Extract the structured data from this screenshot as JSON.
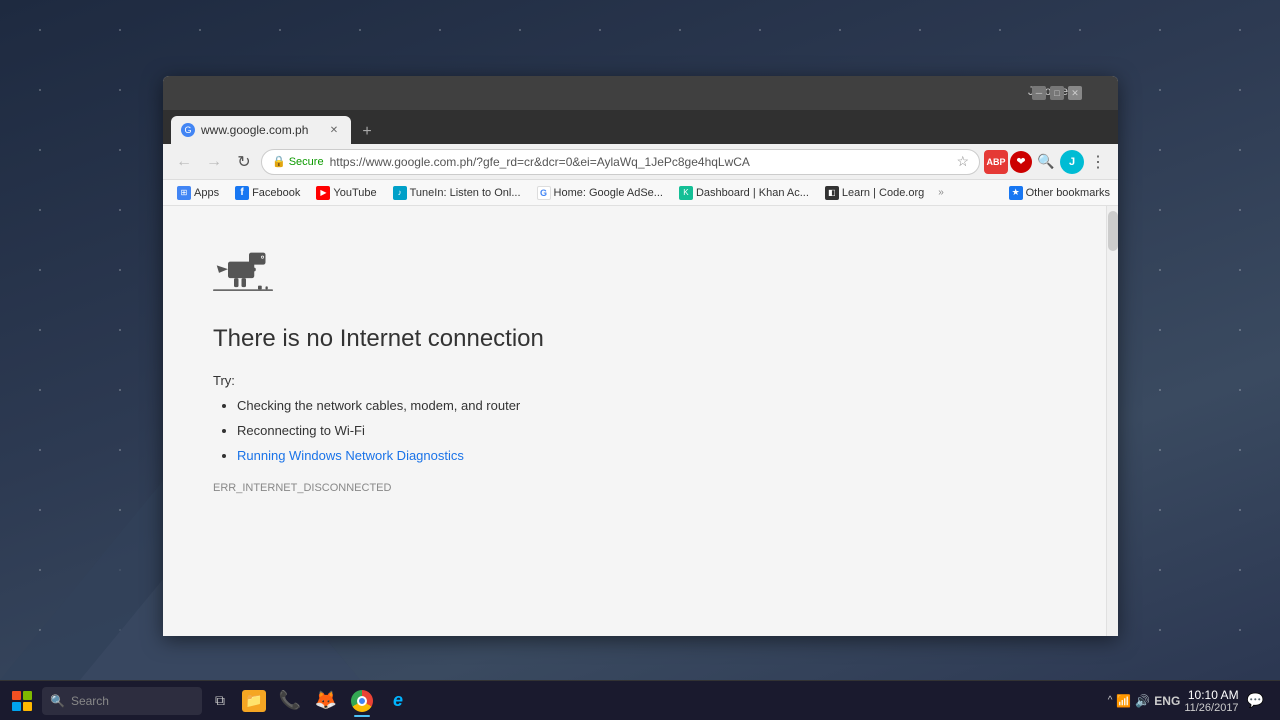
{
  "desktop": {
    "background_note": "dark blue gradient with mountain shapes"
  },
  "browser": {
    "titlebar": {
      "user": "Jerome",
      "minimize_label": "─",
      "maximize_label": "□",
      "close_label": "✕"
    },
    "tab": {
      "favicon_letter": "G",
      "title": "www.google.com.ph",
      "close_label": "✕"
    },
    "new_tab_label": "+",
    "toolbar": {
      "back_label": "←",
      "forward_label": "→",
      "reload_label": "↻",
      "secure_label": "Secure",
      "url": "https://www.google.com.ph/?gfe_rd=cr&dcr=0&ei=AylaWq_1JePc8ge4hqLwCA",
      "star_label": "☆",
      "abp_label": "ABP",
      "menu_label": "⋮"
    },
    "bookmarks": [
      {
        "id": "apps",
        "icon": "⊞",
        "label": "Apps",
        "color": "#4285f4"
      },
      {
        "id": "facebook",
        "icon": "f",
        "label": "Facebook",
        "color": "#1877f2"
      },
      {
        "id": "youtube",
        "icon": "▶",
        "label": "YouTube",
        "color": "#ff0000"
      },
      {
        "id": "tunein",
        "icon": "♪",
        "label": "TuneIn: Listen to Onl...",
        "color": "#00a0c8"
      },
      {
        "id": "google",
        "icon": "G",
        "label": "Home: Google AdSe...",
        "color": "#4285f4"
      },
      {
        "id": "khan",
        "icon": "◈",
        "label": "Dashboard | Khan Ac...",
        "color": "#14bf96"
      },
      {
        "id": "codeorg",
        "icon": "◧",
        "label": "Learn | Code.org",
        "color": "#333"
      }
    ],
    "bookmarks_more_label": "»",
    "bookmarks_other_label": "Other bookmarks"
  },
  "error_page": {
    "title": "There is no Internet connection",
    "try_label": "Try:",
    "suggestions": [
      "Checking the network cables, modem, and router",
      "Reconnecting to Wi-Fi"
    ],
    "link_label": "Running Windows Network Diagnostics",
    "error_code": "ERR_INTERNET_DISCONNECTED"
  },
  "taskbar": {
    "start_icon": "windows",
    "search_placeholder": "Search",
    "time": "10:10 AM",
    "date": "11/26/2017",
    "language": "ENG",
    "apps": [
      {
        "id": "file-explorer",
        "label": "File Explorer"
      },
      {
        "id": "phone",
        "label": "Phone"
      },
      {
        "id": "firefox",
        "label": "Firefox"
      },
      {
        "id": "chrome",
        "label": "Chrome",
        "active": true
      },
      {
        "id": "edge",
        "label": "Edge"
      }
    ],
    "tray": {
      "chevron_label": "^",
      "network_icon": "📶",
      "volume_icon": "🔊",
      "notification_label": "🔔"
    }
  }
}
